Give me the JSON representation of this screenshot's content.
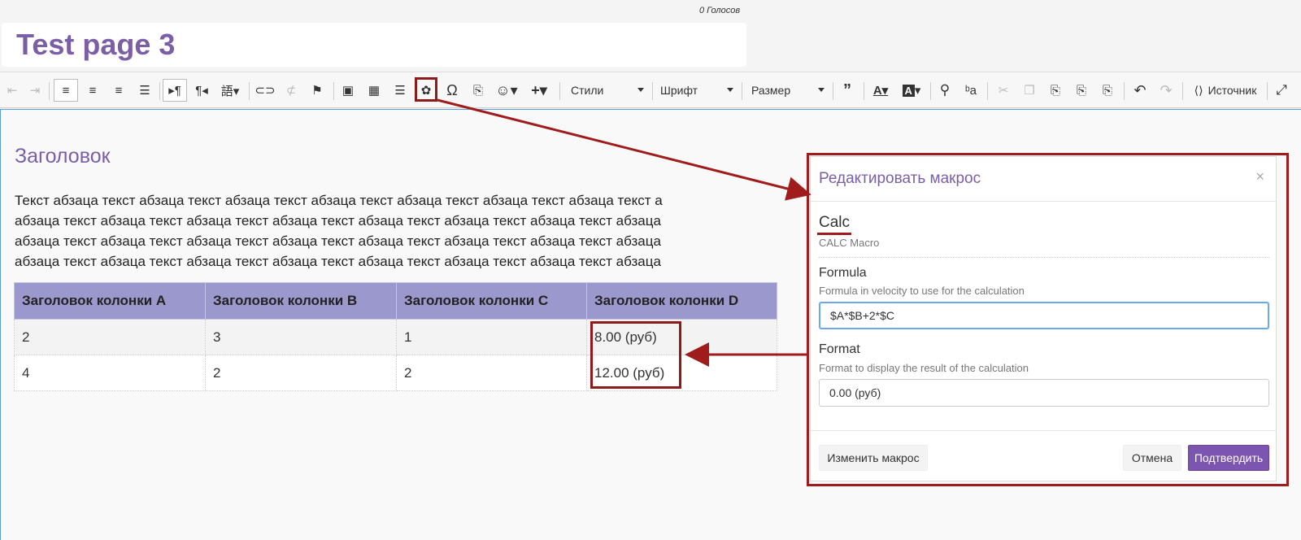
{
  "page": {
    "votes": "0 Голосов",
    "title": "Test page 3"
  },
  "toolbar": {
    "styles_label": "Стили",
    "font_label": "Шрифт",
    "size_label": "Размер",
    "source_label": "Источник"
  },
  "content": {
    "heading": "Заголовок",
    "paragraph_lines": [
      "Текст абзаца текст абзаца текст абзаца текст абзаца текст абзаца текст абзаца текст абзаца текст а",
      "абзаца текст абзаца текст абзаца текст абзаца текст абзаца текст абзаца текст абзаца текст абзаца",
      "абзаца текст абзаца текст абзаца текст абзаца текст абзаца текст абзаца текст абзаца текст абзаца",
      "абзаца текст абзаца текст абзаца текст абзаца текст абзаца текст абзаца текст абзаца текст абзаца"
    ],
    "table": {
      "headers": [
        "Заголовок колонки A",
        "Заголовок колонки B",
        "Заголовок колонки C",
        "Заголовок колонки D"
      ],
      "rows": [
        [
          "2",
          "3",
          "1",
          "8.00 (руб)"
        ],
        [
          "4",
          "2",
          "2",
          "12.00 (руб)"
        ]
      ]
    }
  },
  "modal": {
    "title": "Редактировать макрос",
    "close": "×",
    "macro_name": "Calc",
    "macro_sub": "CALC Macro",
    "formula_label": "Formula",
    "formula_help": "Formula in velocity to use for the calculation",
    "formula_value": "$A*$B+2*$C",
    "format_label": "Format",
    "format_help": "Format to display the result of the calculation",
    "format_value": "0.00 (руб)",
    "change_button": "Изменить макрос",
    "cancel_button": "Отмена",
    "confirm_button": "Подтвердить"
  },
  "colors": {
    "accent_purple": "#7b5fa6",
    "table_header": "#9b98cd",
    "annotation_red": "#a01c1c",
    "primary_button": "#7c55b0"
  },
  "icons": {
    "gear": "gear-icon",
    "omega": "omega-icon",
    "search": "search-icon",
    "maximize": "maximize-icon"
  }
}
